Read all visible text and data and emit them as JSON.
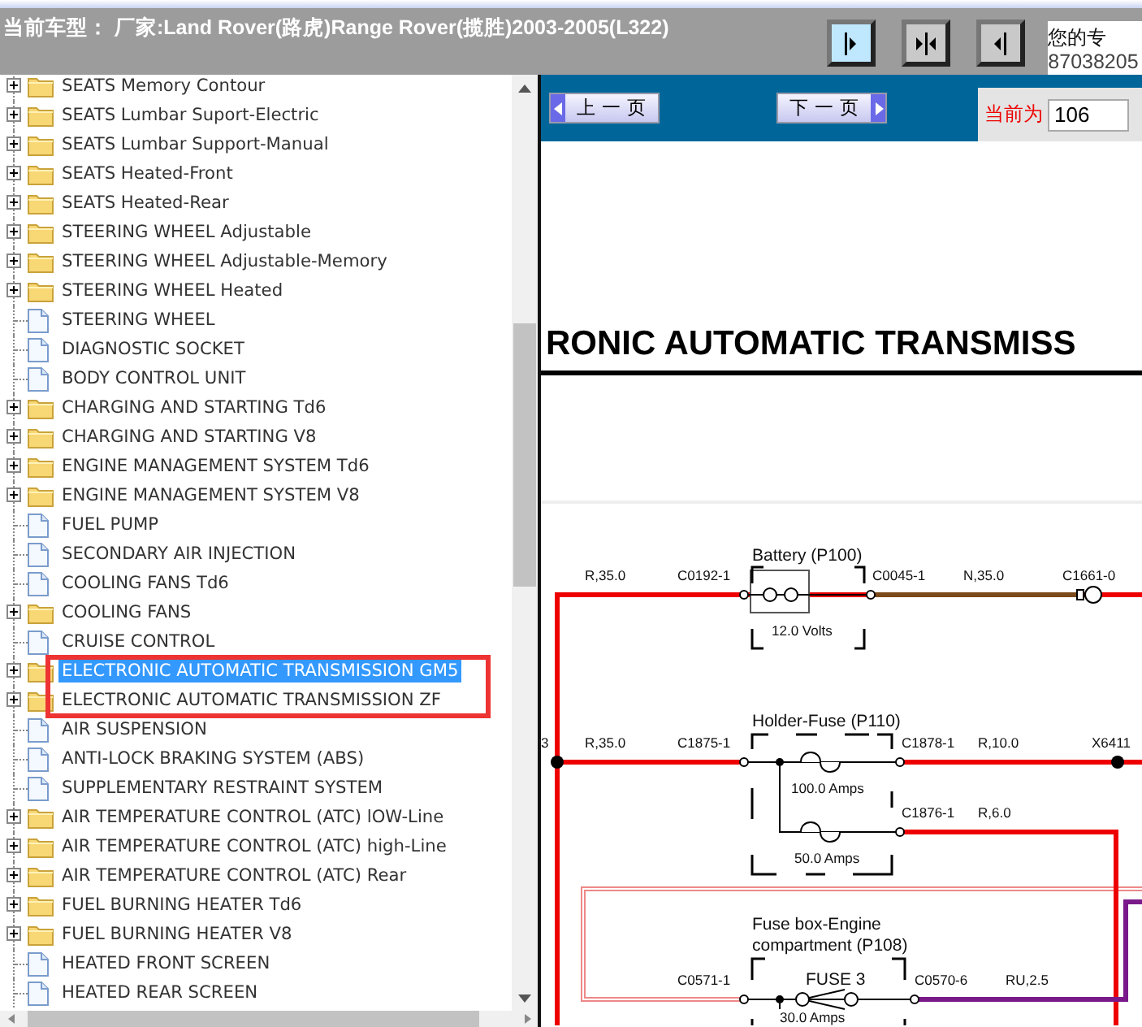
{
  "header": {
    "vehicle": "当前车型： 厂家:Land Rover(路虎)Range Rover(揽胜)2003-2005(L322)",
    "view_buttons": [
      {
        "kind": "right"
      },
      {
        "kind": "both"
      },
      {
        "kind": "left"
      }
    ],
    "contact": [
      "您的专",
      "87038205"
    ]
  },
  "tree": [
    {
      "label": "SEATS Memory Contour",
      "kind": "folder",
      "selected": false
    },
    {
      "label": "SEATS Lumbar Suport-Electric",
      "kind": "folder",
      "selected": false
    },
    {
      "label": "SEATS Lumbar Support-Manual",
      "kind": "folder",
      "selected": false
    },
    {
      "label": "SEATS Heated-Front",
      "kind": "folder",
      "selected": false
    },
    {
      "label": "SEATS Heated-Rear",
      "kind": "folder",
      "selected": false
    },
    {
      "label": "STEERING WHEEL Adjustable",
      "kind": "folder",
      "selected": false
    },
    {
      "label": "STEERING WHEEL Adjustable-Memory",
      "kind": "folder",
      "selected": false
    },
    {
      "label": "STEERING WHEEL Heated",
      "kind": "folder",
      "selected": false
    },
    {
      "label": "STEERING WHEEL",
      "kind": "file",
      "selected": false
    },
    {
      "label": "DIAGNOSTIC SOCKET",
      "kind": "file",
      "selected": false
    },
    {
      "label": "BODY CONTROL UNIT",
      "kind": "file",
      "selected": false
    },
    {
      "label": "CHARGING AND STARTING Td6",
      "kind": "folder",
      "selected": false
    },
    {
      "label": "CHARGING AND STARTING V8",
      "kind": "folder",
      "selected": false
    },
    {
      "label": "ENGINE MANAGEMENT SYSTEM Td6",
      "kind": "folder",
      "selected": false
    },
    {
      "label": "ENGINE MANAGEMENT SYSTEM V8",
      "kind": "folder",
      "selected": false
    },
    {
      "label": "FUEL PUMP",
      "kind": "file",
      "selected": false
    },
    {
      "label": "SECONDARY AIR INJECTION",
      "kind": "file",
      "selected": false
    },
    {
      "label": "COOLING FANS Td6",
      "kind": "file",
      "selected": false
    },
    {
      "label": "COOLING FANS",
      "kind": "folder",
      "selected": false
    },
    {
      "label": "CRUISE CONTROL",
      "kind": "file",
      "selected": false
    },
    {
      "label": "ELECTRONIC AUTOMATIC TRANSMISSION GM5",
      "kind": "folder",
      "selected": true,
      "framed": true
    },
    {
      "label": "ELECTRONIC AUTOMATIC TRANSMISSION ZF",
      "kind": "folder",
      "selected": false,
      "framed": true
    },
    {
      "label": "AIR SUSPENSION",
      "kind": "file",
      "selected": false
    },
    {
      "label": "ANTI-LOCK BRAKING SYSTEM (ABS)",
      "kind": "file",
      "selected": false
    },
    {
      "label": "SUPPLEMENTARY RESTRAINT SYSTEM",
      "kind": "file",
      "selected": false
    },
    {
      "label": "AIR TEMPERATURE CONTROL (ATC) lOW-Line",
      "kind": "folder",
      "selected": false
    },
    {
      "label": "AIR TEMPERATURE CONTROL (ATC) high-Line",
      "kind": "folder",
      "selected": false
    },
    {
      "label": "AIR TEMPERATURE CONTROL (ATC) Rear",
      "kind": "folder",
      "selected": false
    },
    {
      "label": "FUEL BURNING HEATER Td6",
      "kind": "folder",
      "selected": false
    },
    {
      "label": "FUEL BURNING HEATER V8",
      "kind": "folder",
      "selected": false
    },
    {
      "label": "HEATED FRONT SCREEN",
      "kind": "file",
      "selected": false
    },
    {
      "label": "HEATED REAR SCREEN",
      "kind": "file",
      "selected": false
    }
  ],
  "pager": {
    "prev": "上 一 页",
    "next": "下 一 页",
    "current_label": "当前为",
    "current_page": "106"
  },
  "document": {
    "heading": "RONIC AUTOMATIC TRANSMISS",
    "labels": [
      "R,35.0",
      "C0192-1",
      "Battery (P100)",
      "C0045-1",
      "N,35.0",
      "C1661-0",
      "12.0 Volts",
      "3",
      "R,35.0",
      "C1875-1",
      "Holder-Fuse (P110)",
      "C1878-1",
      "R,10.0",
      "X6411",
      "100.0 Amps",
      "C1876-1",
      "R,6.0",
      "50.0 Amps",
      "Fuse box-Engine",
      "compartment (P108)",
      "C0571-1",
      "FUSE 3",
      "C0570-6",
      "RU,2.5",
      "30.0 Amps"
    ]
  }
}
